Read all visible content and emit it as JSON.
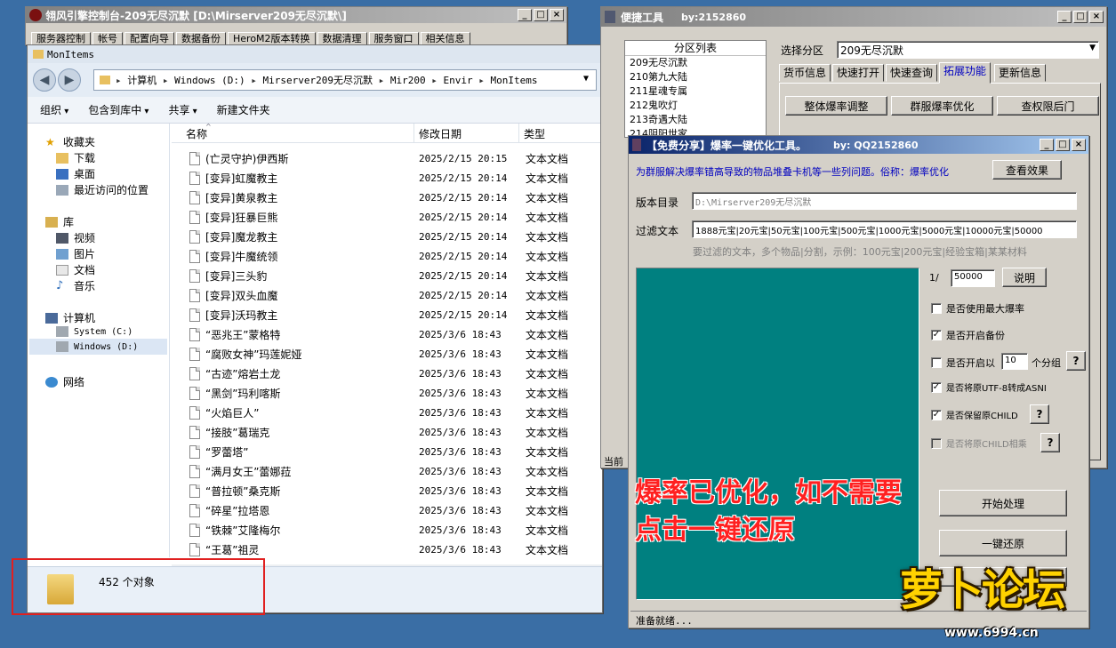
{
  "console_window": {
    "title": "翎风引擎控制台-209无尽沉默 [D:\\Mirserver209无尽沉默\\]",
    "menu": [
      "服务器控制",
      "帐号",
      "配置向导",
      "数据备份",
      "HeroM2版本转换",
      "数据清理",
      "服务窗口",
      "相关信息"
    ]
  },
  "explorer": {
    "title": "MonItems",
    "address": [
      "计算机",
      "Windows (D:)",
      "Mirserver209无尽沉默",
      "Mir200",
      "Envir",
      "MonItems"
    ],
    "toolbar": [
      "组织",
      "包含到库中",
      "共享",
      "新建文件夹"
    ],
    "columns": {
      "name": "名称",
      "date": "修改日期",
      "type": "类型"
    },
    "sidebar": {
      "favorites": "收藏夹",
      "fav_items": [
        "下载",
        "桌面",
        "最近访问的位置"
      ],
      "library": "库",
      "lib_items": [
        "视频",
        "图片",
        "文档",
        "音乐"
      ],
      "computer": "计算机",
      "drives": [
        "System (C:)",
        "Windows (D:)"
      ],
      "network": "网络"
    },
    "files": [
      {
        "name": "(亡灵守护)伊西斯",
        "date": "2025/2/15 20:15",
        "type": "文本文档"
      },
      {
        "name": "[变异]虹魔教主",
        "date": "2025/2/15 20:14",
        "type": "文本文档"
      },
      {
        "name": "[变异]黄泉教主",
        "date": "2025/2/15 20:14",
        "type": "文本文档"
      },
      {
        "name": "[变异]狂暴巨熊",
        "date": "2025/2/15 20:14",
        "type": "文本文档"
      },
      {
        "name": "[变异]魔龙教主",
        "date": "2025/2/15 20:14",
        "type": "文本文档"
      },
      {
        "name": "[变异]牛魔统领",
        "date": "2025/2/15 20:14",
        "type": "文本文档"
      },
      {
        "name": "[变异]三头豹",
        "date": "2025/2/15 20:14",
        "type": "文本文档"
      },
      {
        "name": "[变异]双头血魔",
        "date": "2025/2/15 20:14",
        "type": "文本文档"
      },
      {
        "name": "[变异]沃玛教主",
        "date": "2025/2/15 20:14",
        "type": "文本文档"
      },
      {
        "name": "“恶兆王”蒙格特",
        "date": "2025/3/6 18:43",
        "type": "文本文档"
      },
      {
        "name": "“腐败女神”玛莲妮娅",
        "date": "2025/3/6 18:43",
        "type": "文本文档"
      },
      {
        "name": "“古迹”熔岩土龙",
        "date": "2025/3/6 18:43",
        "type": "文本文档"
      },
      {
        "name": "“黑剑”玛利喀斯",
        "date": "2025/3/6 18:43",
        "type": "文本文档"
      },
      {
        "name": "“火焰巨人”",
        "date": "2025/3/6 18:43",
        "type": "文本文档"
      },
      {
        "name": "“接肢”葛瑞克",
        "date": "2025/3/6 18:43",
        "type": "文本文档"
      },
      {
        "name": "“罗蕾塔”",
        "date": "2025/3/6 18:43",
        "type": "文本文档"
      },
      {
        "name": "“满月女王”蕾娜菈",
        "date": "2025/3/6 18:43",
        "type": "文本文档"
      },
      {
        "name": "“普拉顿”桑克斯",
        "date": "2025/3/6 18:43",
        "type": "文本文档"
      },
      {
        "name": "“碎星”拉塔恩",
        "date": "2025/3/6 18:43",
        "type": "文本文档"
      },
      {
        "name": "“铁棘”艾隆梅尔",
        "date": "2025/3/6 18:43",
        "type": "文本文档"
      },
      {
        "name": "“王葛”祖灵",
        "date": "2025/3/6 18:43",
        "type": "文本文档"
      }
    ],
    "status": "452 个对象"
  },
  "tools": {
    "title": "便捷工具",
    "author": "by:2152860",
    "partition_list_header": "分区列表",
    "partitions": [
      "209无尽沉默",
      "210第九大陆",
      "211星魂专属",
      "212鬼吹灯",
      "213奇遇大陆",
      "214阴阳世家"
    ],
    "select_label": "选择分区",
    "selected": "209无尽沉默",
    "tabs": [
      "货币信息",
      "快速打开",
      "快速查询",
      "拓展功能",
      "更新信息"
    ],
    "buttons": [
      "整体爆率调整",
      "群服爆率优化",
      "查权限后门"
    ],
    "status_prefix": "当前"
  },
  "optimizer": {
    "title": "【免费分享】爆率一键优化工具。",
    "author": "by: QQ2152860",
    "desc": "为群服解决爆率错高导致的物品堆叠卡机等一些列问题。俗称：爆率优化",
    "view_effect": "查看效果",
    "dir_label": "版本目录",
    "dir_value": "D:\\Mirserver209无尽沉默",
    "filter_label": "过滤文本",
    "filter_value": "1888元宝|20元宝|50元宝|100元宝|500元宝|1000元宝|5000元宝|10000元宝|50000",
    "filter_hint": "要过滤的文本，多个物品|分割，示例：100元宝|200元宝|经验宝箱|某某材料",
    "ratio_prefix": "1/",
    "ratio_value": "50000",
    "explain": "说明",
    "checks": [
      {
        "label": "是否使用最大爆率",
        "checked": false
      },
      {
        "label": "是否开启备份",
        "checked": true
      },
      {
        "label": "是否开启以",
        "checked": false
      },
      {
        "label": "是否将原UTF-8转成ASNI",
        "checked": true
      },
      {
        "label": "是否保留原CHILD",
        "checked": true
      },
      {
        "label": "是否将原CHILD相乘",
        "checked": false
      }
    ],
    "group_value": "10",
    "group_suffix": "个分组",
    "q": "?",
    "overlay_line1": "爆率已优化，如不需要",
    "overlay_line2": "点击一键还原",
    "start": "开始处理",
    "restore": "一键还原",
    "status": "准备就绪..."
  },
  "watermark": {
    "brand": "萝卜论坛",
    "url": "www.6994.cn"
  },
  "colors": {
    "teal": "#008080",
    "overlay_text": "#ff2020",
    "highlight_box": "#e02020",
    "desktop": "#3a6ea5"
  }
}
